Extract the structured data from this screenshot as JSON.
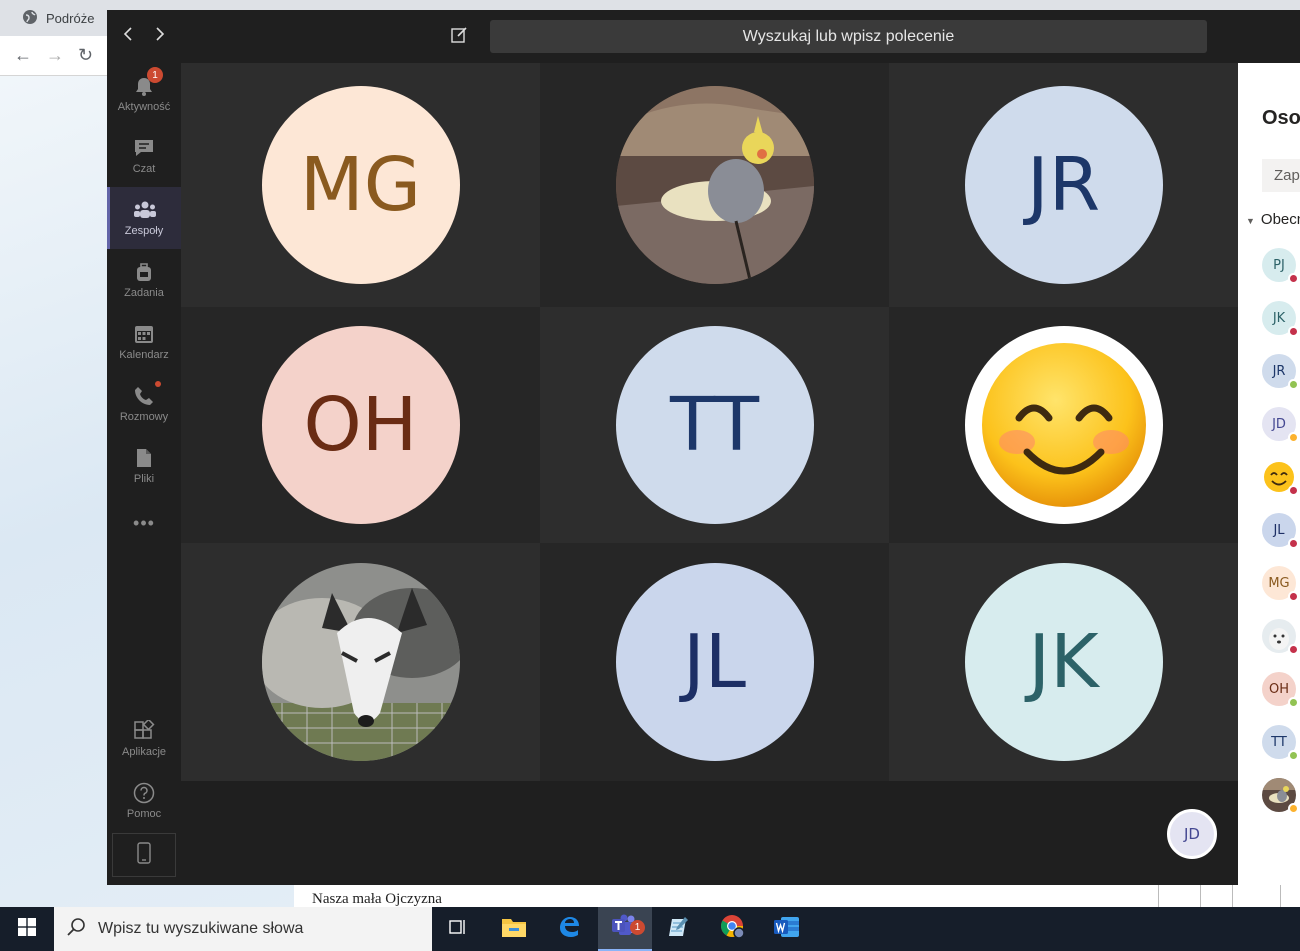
{
  "browser": {
    "tab_title": "Podróże",
    "doc_text": "Nasza mała Ojczyzna"
  },
  "teams": {
    "search_placeholder": "Wyszukaj lub wpisz polecenie",
    "rail": [
      {
        "label": "Aktywność",
        "badge": "1"
      },
      {
        "label": "Czat"
      },
      {
        "label": "Zespoły"
      },
      {
        "label": "Zadania"
      },
      {
        "label": "Kalendarz"
      },
      {
        "label": "Rozmowy"
      },
      {
        "label": "Pliki"
      },
      {
        "label": "Aplikacje"
      },
      {
        "label": "Pomoc"
      }
    ],
    "more_label": "•••",
    "participants": [
      {
        "initials": "MG",
        "bg": "#fde7d6",
        "fg": "#8a5a1f"
      },
      {
        "initials": "",
        "image": "cockatiel-photo"
      },
      {
        "initials": "JR",
        "bg": "#cfdbec",
        "fg": "#1d3769"
      },
      {
        "initials": "OH",
        "bg": "#f4d2ca",
        "fg": "#6a2c14"
      },
      {
        "initials": "TT",
        "bg": "#cfdbec",
        "fg": "#1d3769"
      },
      {
        "initials": "",
        "image": "smiling-emoji"
      },
      {
        "initials": "",
        "image": "fox-photo"
      },
      {
        "initials": "JL",
        "bg": "#cad6ec",
        "fg": "#1d2f65"
      },
      {
        "initials": "JK",
        "bg": "#d7ecee",
        "fg": "#2c6268"
      }
    ],
    "self_initials": "JD"
  },
  "people_panel": {
    "title": "Osoby",
    "invite_placeholder": "Zaproś",
    "present_header": "Obecni",
    "people": [
      {
        "initials": "PJ",
        "bg": "#d7ecee",
        "fg": "#2c6268",
        "status": "busy"
      },
      {
        "initials": "JK",
        "bg": "#d7ecee",
        "fg": "#2c6268",
        "status": "busy"
      },
      {
        "initials": "JR",
        "bg": "#cfdbec",
        "fg": "#1d3769",
        "status": "available"
      },
      {
        "initials": "JD",
        "bg": "#e4e4f2",
        "fg": "#444791",
        "status": "away"
      },
      {
        "initials": "",
        "image": "smiling-emoji",
        "status": "busy"
      },
      {
        "initials": "JL",
        "bg": "#cad6ec",
        "fg": "#1d2f65",
        "status": "busy"
      },
      {
        "initials": "MG",
        "bg": "#fde7d6",
        "fg": "#8a5a1f",
        "status": "busy"
      },
      {
        "initials": "",
        "image": "dog-photo",
        "status": "busy"
      },
      {
        "initials": "OH",
        "bg": "#f4d2ca",
        "fg": "#6a2c14",
        "status": "available"
      },
      {
        "initials": "TT",
        "bg": "#cfdbec",
        "fg": "#1d3769",
        "status": "available"
      },
      {
        "initials": "",
        "image": "cockatiel-photo",
        "status": "away"
      }
    ],
    "status_colors": {
      "busy": "#c4314b",
      "available": "#92c353",
      "away": "#fcb22e"
    }
  },
  "taskbar": {
    "search_placeholder": "Wpisz tu wyszukiwane słowa",
    "teams_badge": "1",
    "apps": [
      "task-view-icon",
      "file-explorer-icon",
      "edge-icon",
      "teams-icon",
      "notepad-icon",
      "chrome-icon",
      "word-icon"
    ]
  }
}
